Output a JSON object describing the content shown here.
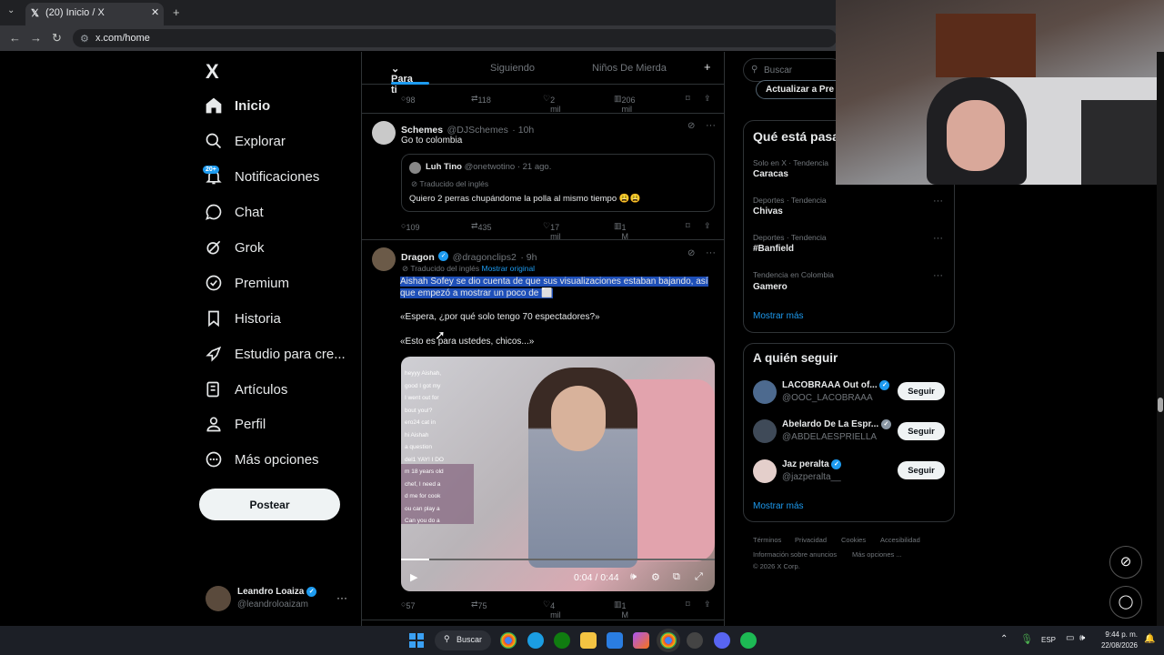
{
  "browser": {
    "tab_title": "(20) Inicio / X",
    "url": "x.com/home",
    "new_tab": "+"
  },
  "sidebar": {
    "logo": "X",
    "items": [
      {
        "label": "Inicio",
        "icon": "home-icon"
      },
      {
        "label": "Explorar",
        "icon": "search-icon"
      },
      {
        "label": "Notificaciones",
        "icon": "bell-icon",
        "badge": "20+"
      },
      {
        "label": "Chat",
        "icon": "chat-icon"
      },
      {
        "label": "Grok",
        "icon": "grok-icon"
      },
      {
        "label": "Premium",
        "icon": "premium-icon"
      },
      {
        "label": "Historia",
        "icon": "bookmark-icon"
      },
      {
        "label": "Estudio para cre...",
        "icon": "rocket-icon"
      },
      {
        "label": "Artículos",
        "icon": "article-icon"
      },
      {
        "label": "Perfil",
        "icon": "person-icon"
      },
      {
        "label": "Más opciones",
        "icon": "more-circle-icon"
      }
    ],
    "post_label": "Postear",
    "account": {
      "name": "Leandro Loaiza",
      "handle": "@leandroloaizam"
    }
  },
  "feed": {
    "tabs": [
      "Para ti",
      "Siguiendo",
      "Niños De Mierda"
    ],
    "top_actions": {
      "replies": "98",
      "reposts": "118",
      "likes": "2 mil",
      "views": "206 mil"
    },
    "tweet1": {
      "name": "Schemes",
      "handle": "@DJSchemes",
      "time": "· 10h",
      "text": "Go to colombia",
      "quote": {
        "name": "Luh Tino",
        "handle": "@onetwotino",
        "time": "· 21 ago.",
        "translated": "Traducido del inglés",
        "text": "Quiero 2 perras chupándome la polla al mismo tiempo 😩😩"
      },
      "actions": {
        "replies": "109",
        "reposts": "435",
        "likes": "17 mil",
        "views": "1 M"
      }
    },
    "tweet2": {
      "name": "Dragon",
      "handle": "@dragonclips2",
      "time": "· 9h",
      "translated": "Traducido del inglés",
      "show_original": "Mostrar original",
      "line1": "Aishah Sofey se dio cuenta de que sus visualizaciones estaban bajando, así",
      "line2": "que empezó a mostrar un poco de",
      "quote1": "«Espera, ¿por qué solo tengo 70 espectadores?»",
      "quote2": "«Esto es para ustedes, chicos...»",
      "video": {
        "time": "0:04 / 0:44",
        "chat": [
          "heyyy Aishah,",
          "good I got my",
          "I went out for",
          "bout you!?",
          "ero24  cat in",
          "hi Aishah",
          "a question",
          "del1  YAY! I DO",
          "m 18 years old",
          "chef, I need a",
          "d me for cook",
          "ou can play a",
          "Can you do a"
        ]
      },
      "actions": {
        "replies": "57",
        "reposts": "75",
        "likes": "4 mil",
        "views": "1 M"
      }
    }
  },
  "right": {
    "search_placeholder": "Buscar",
    "premium_btn": "Actualizar a Pre",
    "trends_title": "Qué está pasa",
    "trends": [
      {
        "meta": "Solo en X · Tendencia",
        "name": "Caracas"
      },
      {
        "meta": "Deportes · Tendencia",
        "name": "Chivas"
      },
      {
        "meta": "Deportes · Tendencia",
        "name": "#Banfield"
      },
      {
        "meta": "Tendencia en Colombia",
        "name": "Gamero"
      }
    ],
    "show_more": "Mostrar más",
    "follow_title": "A quién seguir",
    "follow": [
      {
        "name": "LACOBRAAA Out of...",
        "handle": "@OOC_LACOBRAAA"
      },
      {
        "name": "Abelardo De La Espr...",
        "handle": "@ABDELAESPRIELLA"
      },
      {
        "name": "Jaz peralta",
        "handle": "@jazperalta__"
      }
    ],
    "follow_label": "Seguir",
    "footer": [
      "Términos",
      "Privacidad",
      "Cookies",
      "Accesibilidad",
      "Información sobre anuncios",
      "Más opciones ...",
      "© 2026 X Corp."
    ]
  },
  "taskbar": {
    "search": "Buscar",
    "lang": "ESP",
    "time": "9:44 p. m.",
    "date": "22/08/2026"
  },
  "colors": {
    "accent": "#1d9bf0",
    "background": "#000000",
    "border": "#2f3336"
  }
}
